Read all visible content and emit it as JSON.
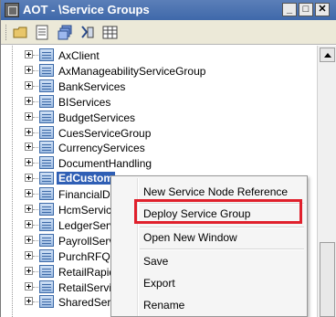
{
  "window": {
    "title": "AOT - \\Service Groups",
    "controls": {
      "minimize": "_",
      "maximize": "□",
      "close": "✕"
    }
  },
  "toolbar": {
    "icons": [
      "open-icon",
      "properties-icon",
      "layers-icon",
      "compile-icon",
      "grid-icon"
    ]
  },
  "tree": {
    "items": [
      {
        "label": "AxClient"
      },
      {
        "label": "AxManageabilityServiceGroup"
      },
      {
        "label": "BankServices"
      },
      {
        "label": "BIServices"
      },
      {
        "label": "BudgetServices"
      },
      {
        "label": "CuesServiceGroup"
      },
      {
        "label": "CurrencyServices"
      },
      {
        "label": "DocumentHandling"
      },
      {
        "label": "EdCustom",
        "selected": true
      },
      {
        "label": "FinancialDim"
      },
      {
        "label": "HcmServices"
      },
      {
        "label": "LedgerServi"
      },
      {
        "label": "PayrollServic"
      },
      {
        "label": "PurchRFQ"
      },
      {
        "label": "RetailRapidS"
      },
      {
        "label": "RetailService"
      },
      {
        "label": "SharedServi"
      }
    ]
  },
  "context_menu": {
    "new_service_node_reference": "New Service Node Reference",
    "deploy_service_group": "Deploy Service Group",
    "open_new_window": "Open New Window",
    "save": "Save",
    "export": "Export",
    "rename": "Rename"
  },
  "colors": {
    "title_bar": "#3f69aa",
    "selection": "#2f5fb5",
    "highlight_box": "#e0202c"
  }
}
